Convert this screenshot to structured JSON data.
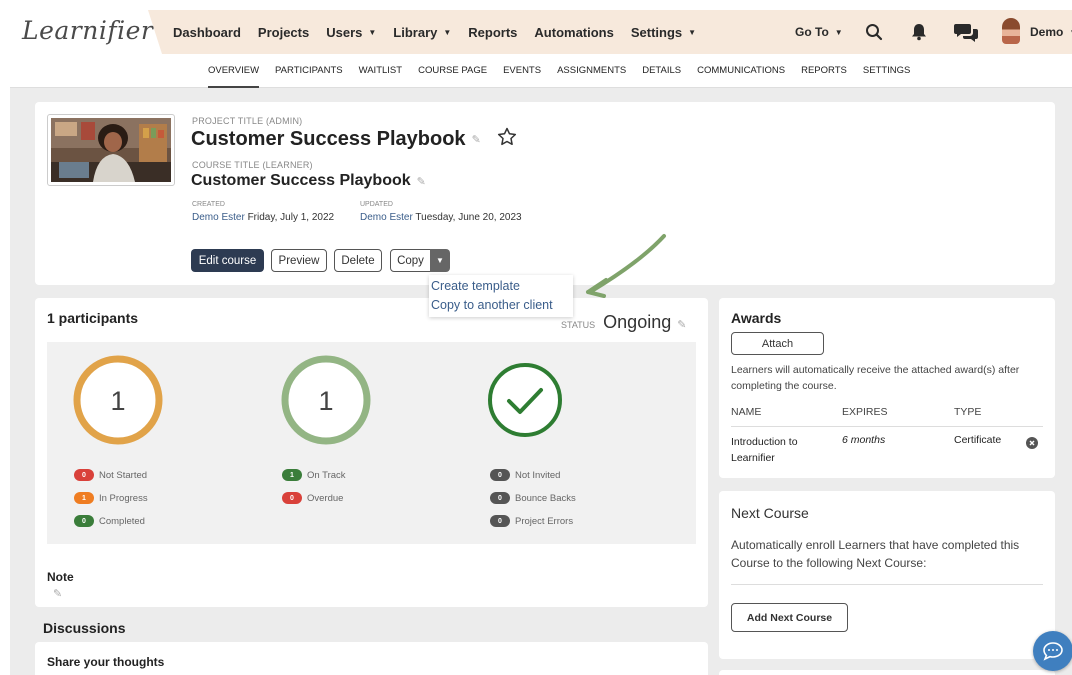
{
  "topnav": {
    "logo": "Learnifier",
    "items": [
      {
        "label": "Dashboard",
        "caret": false
      },
      {
        "label": "Projects",
        "caret": false
      },
      {
        "label": "Users",
        "caret": true
      },
      {
        "label": "Library",
        "caret": true
      },
      {
        "label": "Reports",
        "caret": false
      },
      {
        "label": "Automations",
        "caret": false
      },
      {
        "label": "Settings",
        "caret": true
      }
    ],
    "goto_label": "Go To",
    "user_label": "Demo"
  },
  "subnav": {
    "tabs": [
      "OVERVIEW",
      "PARTICIPANTS",
      "WAITLIST",
      "COURSE PAGE",
      "EVENTS",
      "ASSIGNMENTS",
      "DETAILS",
      "COMMUNICATIONS",
      "REPORTS",
      "SETTINGS"
    ],
    "active": "OVERVIEW"
  },
  "project": {
    "project_title_label": "PROJECT TITLE (ADMIN)",
    "project_title": "Customer Success Playbook",
    "course_title_label": "COURSE TITLE (LEARNER)",
    "course_title": "Customer Success Playbook",
    "created_label": "CREATED",
    "created_by": "Demo Ester",
    "created_date": "Friday, July 1, 2022",
    "updated_label": "UPDATED",
    "updated_by": "Demo Ester",
    "updated_date": "Tuesday, June 20, 2023",
    "buttons": {
      "edit": "Edit course",
      "preview": "Preview",
      "delete": "Delete",
      "copy": "Copy"
    },
    "copy_menu": [
      "Create template",
      "Copy to another client"
    ]
  },
  "participants": {
    "title": "1 participants",
    "status_label": "STATUS",
    "status_value": "Ongoing",
    "ring1_value": "1",
    "ring2_value": "1",
    "col1": [
      {
        "count": "0",
        "label": "Not Started",
        "color": "#d9413a"
      },
      {
        "count": "1",
        "label": "In Progress",
        "color": "#ef7d22"
      },
      {
        "count": "0",
        "label": "Completed",
        "color": "#3a7d3a"
      }
    ],
    "col2": [
      {
        "count": "1",
        "label": "On Track",
        "color": "#3a7d3a"
      },
      {
        "count": "0",
        "label": "Overdue",
        "color": "#d9413a"
      }
    ],
    "col3": [
      {
        "count": "0",
        "label": "Not Invited",
        "color": "#555555"
      },
      {
        "count": "0",
        "label": "Bounce Backs",
        "color": "#555555"
      },
      {
        "count": "0",
        "label": "Project Errors",
        "color": "#555555"
      }
    ],
    "note_label": "Note"
  },
  "discussions": {
    "title": "Discussions",
    "share_label": "Share your thoughts"
  },
  "awards": {
    "title": "Awards",
    "attach_label": "Attach",
    "description": "Learners will automatically receive the attached award(s) after completing the course.",
    "col_name": "NAME",
    "col_expires": "EXPIRES",
    "col_type": "TYPE",
    "row": {
      "name": "Introduction to Learnifier",
      "expires": "6 months",
      "type": "Certificate"
    }
  },
  "next_course": {
    "title": "Next Course",
    "description": "Automatically enroll Learners that have completed this Course to the following Next Course:",
    "button": "Add Next Course"
  },
  "colors": {
    "ring_orange": "#e1a349",
    "ring_sage": "#93b584",
    "ring_green": "#2e7d32",
    "nav_bg": "#f7e9dc",
    "primary_button": "#2d3b52",
    "link": "#3a5d8a"
  }
}
